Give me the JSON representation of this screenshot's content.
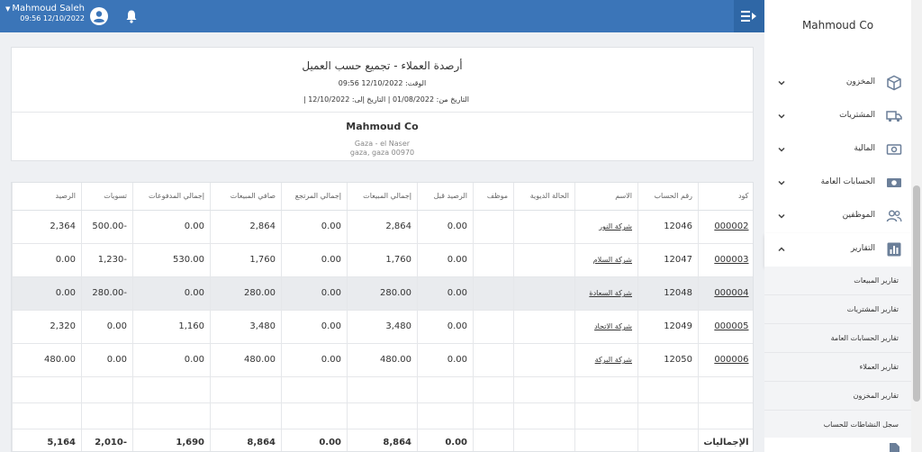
{
  "topbar": {
    "user_name": "Mahmoud Saleh",
    "user_datetime": "09:56 12/10/2022",
    "icons": [
      "caret-down-icon",
      "user-circle-icon",
      "bell-icon",
      "menu-toggle-icon"
    ],
    "bar_color": "#3b75b8"
  },
  "report": {
    "title": "أرصدة العملاء - تجميع حسب العميل",
    "time_line": "الوقت: 12/10/2022 09:56",
    "date_range_line": "التاريخ من: 01/08/2022 | التاريخ إلى: 12/10/2022 |",
    "company_name": "Mahmoud Co",
    "address_line1": "Gaza - el Naser",
    "address_line2": "gaza, gaza 00970"
  },
  "table": {
    "headers": [
      "كود",
      "رقم الحساب",
      "الاسم",
      "الحالة الديوية",
      "موظف",
      "الرصيد قبل",
      "إجمالي المبيعات",
      "إجمالي المرتجع",
      "صافي المبيعات",
      "إجمالي المدفوعات",
      "تسويات",
      "الرصيد"
    ],
    "rows": [
      [
        "000002",
        "12046",
        "شركة النور",
        "",
        "",
        "0.00",
        "2,864",
        "0.00",
        "2,864",
        "0.00",
        "-500.00",
        "2,364"
      ],
      [
        "000003",
        "12047",
        "شركة السلام",
        "",
        "",
        "0.00",
        "1,760",
        "0.00",
        "1,760",
        "530.00",
        "-1,230",
        "0.00"
      ],
      [
        "000004",
        "12048",
        "شركة السعادة",
        "",
        "",
        "0.00",
        "280.00",
        "0.00",
        "280.00",
        "0.00",
        "-280.00",
        "0.00"
      ],
      [
        "000005",
        "12049",
        "شركة الاتحاد",
        "",
        "",
        "0.00",
        "3,480",
        "0.00",
        "3,480",
        "1,160",
        "0.00",
        "2,320"
      ],
      [
        "000006",
        "12050",
        "شركة البركة",
        "",
        "",
        "0.00",
        "480.00",
        "0.00",
        "480.00",
        "0.00",
        "0.00",
        "480.00"
      ]
    ],
    "highlighted_row": 2,
    "totals": [
      "الإجماليات",
      "",
      "",
      "",
      "",
      "0.00",
      "8,864",
      "0.00",
      "8,864",
      "1,690",
      "-2,010",
      "5,164"
    ]
  },
  "sidebar": {
    "brand": "Mahmoud Co",
    "nav": [
      {
        "label": "المخزون",
        "icon": "box-icon",
        "expanded": false
      },
      {
        "label": "المشتريات",
        "icon": "truck-icon",
        "expanded": false
      },
      {
        "label": "المالية",
        "icon": "cash-icon",
        "expanded": false
      },
      {
        "label": "الحسابات العامة",
        "icon": "money-bill-icon",
        "expanded": false
      },
      {
        "label": "الموظفين",
        "icon": "users-icon",
        "expanded": false
      },
      {
        "label": "التقارير",
        "icon": "bar-chart-icon",
        "expanded": true
      }
    ],
    "sub_items": [
      "تقارير المبيعات",
      "تقارير المشتريات",
      "تقارير الحسابات العامة",
      "تقارير العملاء",
      "تقارير المخزون",
      "سجل النشاطات للحساب"
    ],
    "accent_color": "#6b7f99"
  }
}
